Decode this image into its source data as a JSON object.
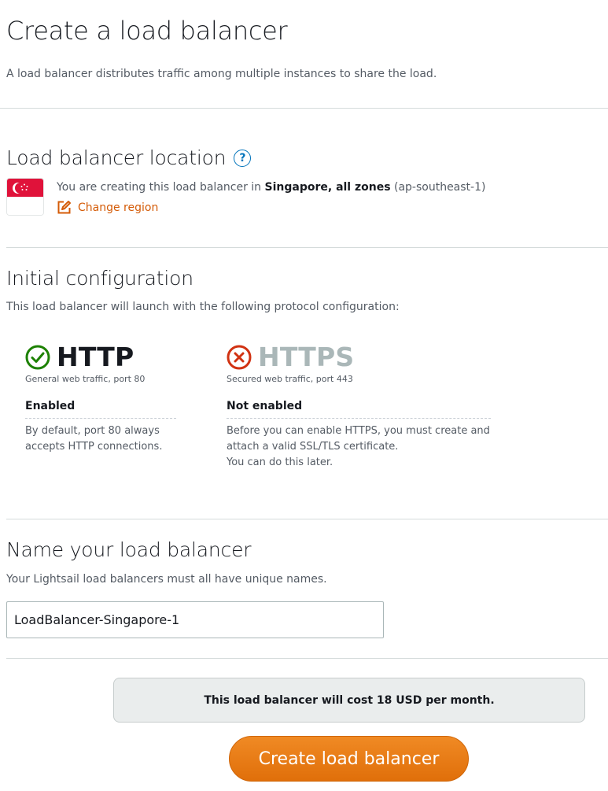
{
  "header": {
    "title": "Create a load balancer",
    "description": "A load balancer distributes traffic among multiple instances to share the load."
  },
  "location": {
    "title": "Load balancer location",
    "help_icon": "?",
    "text_prefix": "You are creating this load balancer in ",
    "region_name": "Singapore, all zones",
    "region_code": " (ap-southeast-1)",
    "change_region_label": "Change region",
    "flag": "singapore-flag-icon"
  },
  "config": {
    "title": "Initial configuration",
    "description": "This load balancer will launch with the following protocol configuration:",
    "protocols": [
      {
        "name": "HTTP",
        "subtitle": "General web traffic, port 80",
        "status": "Enabled",
        "desc_line1": "By default, port 80 always",
        "desc_line2": "accepts HTTP connections.",
        "icon": "check-circle-icon",
        "color": "#1d8102"
      },
      {
        "name": "HTTPS",
        "subtitle": "Secured web traffic, port 443",
        "status": "Not enabled",
        "desc_line1": "Before you can enable HTTPS, you must create and",
        "desc_line2": "attach a valid SSL/TLS certificate.",
        "desc_line3": "You can do this later.",
        "icon": "x-circle-icon",
        "color": "#d13212"
      }
    ]
  },
  "naming": {
    "title": "Name your load balancer",
    "description": "Your Lightsail load balancers must all have unique names.",
    "input_value": "LoadBalancer-Singapore-1"
  },
  "footer": {
    "cost_text": "This load balancer will cost 18 USD per month.",
    "create_button_label": "Create load balancer"
  },
  "colors": {
    "accent_orange": "#ec7211",
    "link_orange": "#d45b07",
    "help_blue": "#0073bb",
    "http_green": "#1d8102",
    "https_red": "#d13212"
  }
}
